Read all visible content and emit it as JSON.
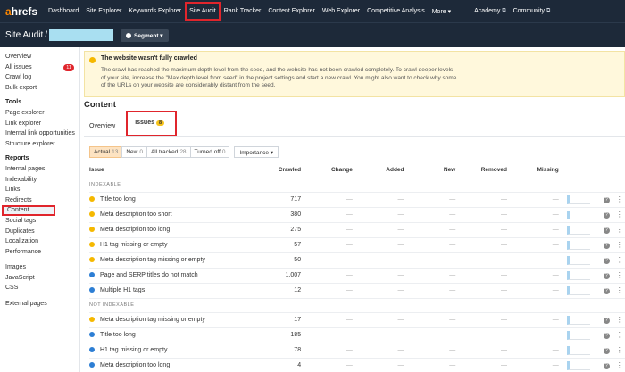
{
  "nav": {
    "logo_a": "a",
    "logo_rest": "hrefs",
    "items": [
      "Dashboard",
      "Site Explorer",
      "Keywords Explorer",
      "Site Audit",
      "Rank Tracker",
      "Content Explorer",
      "Web Explorer",
      "Competitive Analysis",
      "More ▾"
    ],
    "right_items": [
      "Academy",
      "Community"
    ],
    "external_icon": "⧉"
  },
  "subbar": {
    "title": "Site Audit",
    "slash": "/",
    "segment_label": "Segment ▾"
  },
  "sidebar": {
    "top": [
      "Overview",
      "All issues",
      "Crawl log",
      "Bulk export"
    ],
    "all_issues_badge": "11",
    "tools_heading": "Tools",
    "tools": [
      "Page explorer",
      "Link explorer",
      "Internal link opportunities",
      "Structure explorer"
    ],
    "reports_heading": "Reports",
    "reports": [
      "Internal pages",
      "Indexability",
      "Links",
      "Redirects",
      "Content",
      "Social tags",
      "Duplicates",
      "Localization",
      "Performance"
    ],
    "assets": [
      "Images",
      "JavaScript",
      "CSS"
    ],
    "external": [
      "External pages"
    ]
  },
  "alert": {
    "title": "The website wasn't fully crawled",
    "body": "The crawl has reached the maximum depth level from the seed, and the website has not been crawled completely. To crawl deeper levels of your site, increase the \"Max depth level from seed\" in the project settings and start a new crawl. You might also want to check why some of the URLs on your website are considerably distant from the seed."
  },
  "content": {
    "title": "Content",
    "tab_overview": "Overview",
    "tab_issues": "Issues",
    "issues_badge": "8"
  },
  "filters": {
    "actual_label": "Actual",
    "actual_count": "13",
    "new_label": "New",
    "new_count": "0",
    "all_label": "All tracked",
    "all_count": "28",
    "off_label": "Turned off",
    "off_count": "0",
    "importance": "Importance ▾"
  },
  "table": {
    "headers": {
      "issue": "Issue",
      "crawled": "Crawled",
      "change": "Change",
      "added": "Added",
      "new": "New",
      "removed": "Removed",
      "missing": "Missing"
    },
    "section_indexable": "INDEXABLE",
    "section_not_indexable": "NOT INDEXABLE",
    "dash": "—",
    "rows": [
      {
        "type": "warning",
        "issue": "Title too long",
        "crawled": "717"
      },
      {
        "type": "warning",
        "issue": "Meta description too short",
        "crawled": "380"
      },
      {
        "type": "warning",
        "issue": "Meta description too long",
        "crawled": "275"
      },
      {
        "type": "warning",
        "issue": "H1 tag missing or empty",
        "crawled": "57"
      },
      {
        "type": "warning",
        "issue": "Meta description tag missing or empty",
        "crawled": "50"
      },
      {
        "type": "notice",
        "issue": "Page and SERP titles do not match",
        "crawled": "1,007"
      },
      {
        "type": "notice",
        "issue": "Multiple H1 tags",
        "crawled": "12"
      },
      {
        "type": "warning",
        "issue": "Meta description tag missing or empty",
        "crawled": "17"
      },
      {
        "type": "notice",
        "issue": "Title too long",
        "crawled": "185"
      },
      {
        "type": "notice",
        "issue": "H1 tag missing or empty",
        "crawled": "78"
      },
      {
        "type": "notice",
        "issue": "Meta description too long",
        "crawled": "4"
      }
    ]
  },
  "icons": {
    "help": "?",
    "more": "⋮"
  }
}
